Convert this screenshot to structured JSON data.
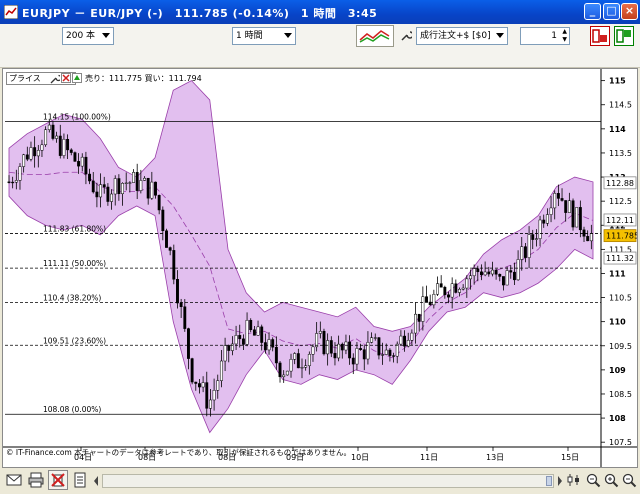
{
  "window": {
    "title": "EURJPY － EUR/JPY (-)　111.785 (-0.14%)　1 時間　3:45",
    "minimize": "_",
    "maximize": "□",
    "close": "×"
  },
  "toolbar": {
    "bars_count": "200 本",
    "period": "1 時間",
    "order_type": "成行注文+$ [$0]",
    "quantity": "1"
  },
  "chart": {
    "price_label": "プライス",
    "quote": "売り：111.775 買い：111.794",
    "copyright": "© IT-Finance.com 本チャートのデータは参考レートであり、取引が保証されるものではありません。",
    "price_tags": [
      {
        "value": "112.88",
        "price": 112.88,
        "highlight": false
      },
      {
        "value": "112.11",
        "price": 112.11,
        "highlight": false
      },
      {
        "value": "111.785",
        "price": 111.785,
        "highlight": true
      },
      {
        "value": "111.32",
        "price": 111.32,
        "highlight": false
      }
    ],
    "colors": {
      "band_fill": "#E2BFEF",
      "band_stroke": "#9A3FAA",
      "candle": "#000000",
      "current": "#F4C000"
    }
  },
  "chart_data": {
    "type": "candlestick",
    "y_ticks": [
      "115",
      "114.5",
      "114",
      "113.5",
      "113",
      "112.5",
      "112",
      "111.5",
      "111",
      "110.5",
      "110",
      "109.5",
      "109",
      "108.5",
      "108",
      "107.5"
    ],
    "ylim": [
      107.4,
      115.2
    ],
    "x_ticks": [
      "04日",
      "08日",
      "08日",
      "09日",
      "10日",
      "11日",
      "13日",
      "15日"
    ],
    "fibonacci": [
      {
        "label": "114.15 (100.00%)",
        "value": 114.15,
        "solid": true
      },
      {
        "label": "111.83 (61.80%)",
        "value": 111.83,
        "solid": false
      },
      {
        "label": "111.11 (50.00%)",
        "value": 111.11,
        "solid": false
      },
      {
        "label": "110.4 (38.20%)",
        "value": 110.4,
        "solid": false
      },
      {
        "label": "109.51 (23.60%)",
        "value": 109.51,
        "solid": false
      },
      {
        "label": "108.08 (0.00%)",
        "value": 108.08,
        "solid": true
      }
    ],
    "bands_upper": [
      113.6,
      113.9,
      114.1,
      114.3,
      114.2,
      113.8,
      113.2,
      113.0,
      113.4,
      114.8,
      115.0,
      114.6,
      111.5,
      110.6,
      110.2,
      110.4,
      110.3,
      110.2,
      110.1,
      110.3,
      109.9,
      109.8,
      109.9,
      110.3,
      110.6,
      110.9,
      111.4,
      111.7,
      111.9,
      112.2,
      112.8,
      113.0,
      112.9
    ],
    "bands_lower": [
      112.6,
      112.2,
      112.0,
      111.9,
      112.0,
      111.8,
      112.2,
      112.4,
      112.2,
      110.0,
      108.6,
      107.7,
      108.2,
      108.9,
      109.4,
      108.8,
      108.7,
      108.9,
      108.8,
      109.0,
      108.9,
      108.7,
      109.2,
      109.8,
      110.2,
      110.3,
      110.6,
      110.5,
      110.6,
      110.8,
      111.1,
      111.5,
      111.3
    ],
    "close_path": [
      112.9,
      113.5,
      113.9,
      113.6,
      113.2,
      112.6,
      112.9,
      112.9,
      112.7,
      111.2,
      109.0,
      108.3,
      109.4,
      109.8,
      109.6,
      109.0,
      109.2,
      109.6,
      109.4,
      109.3,
      109.5,
      109.3,
      109.9,
      110.4,
      110.7,
      110.9,
      111.1,
      110.8,
      111.2,
      111.9,
      112.8,
      112.2,
      111.8
    ]
  },
  "footer": {
    "icons": [
      "mail-icon",
      "print-icon",
      "delete-icon",
      "doc-icon",
      "chart-type-icon",
      "zoom-fit-icon",
      "zoom-in-icon",
      "zoom-out-icon"
    ]
  }
}
